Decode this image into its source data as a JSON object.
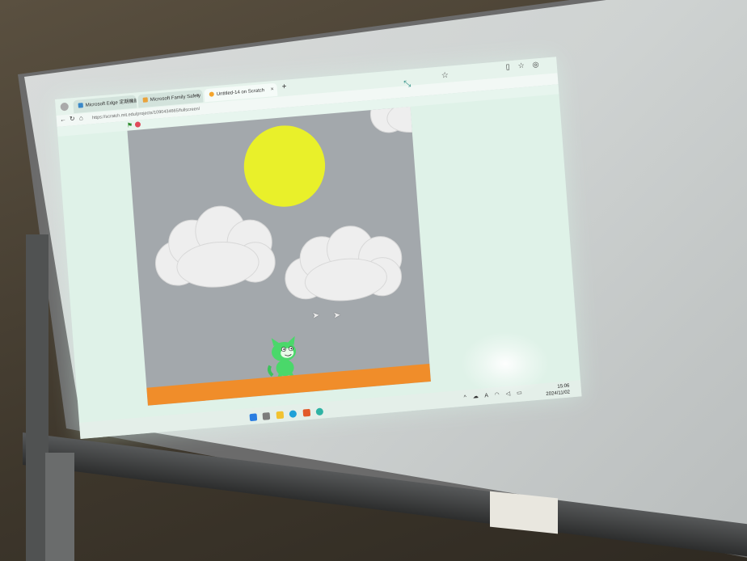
{
  "browser": {
    "tabs": [
      {
        "label": "Microsoft Edge 定期機能",
        "icon": "edge-icon"
      },
      {
        "label": "Microsoft Family Safety",
        "icon": "family-safety-icon"
      },
      {
        "label": "Untitled-14 on Scratch",
        "icon": "scratch-icon"
      }
    ],
    "new_tab_label": "+",
    "tab_close_glyph": "×",
    "url": "https://scratch.mit.edu/projects/1090434665/fullscreen/"
  },
  "scratch": {
    "flag_icon": "green-flag-icon",
    "stop_icon": "stop-icon"
  },
  "taskbar": {
    "time": "15:06",
    "date": "2024/11/02",
    "ime_label": "A"
  },
  "colors": {
    "stage_bg": "#a3a8ac",
    "sun": "#e9f02a",
    "ground": "#f08d2a",
    "cat": "#4ad86a"
  }
}
